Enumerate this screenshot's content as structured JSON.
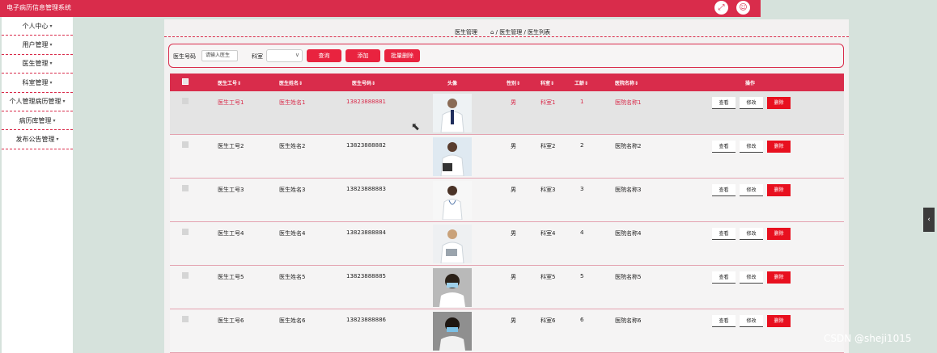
{
  "app": {
    "title": "电子病历信息管理系统"
  },
  "top_icons": [
    "fullscreen-icon",
    "user-icon"
  ],
  "sidebar": {
    "items": [
      {
        "label": "个人中心"
      },
      {
        "label": "用户管理"
      },
      {
        "label": "医生管理"
      },
      {
        "label": "科室管理"
      },
      {
        "label": "个人管理病历管理"
      },
      {
        "label": "病历库管理"
      },
      {
        "label": "发布公告管理"
      }
    ]
  },
  "breadcrumb": {
    "title": "医生管理",
    "path": "⌂ / 医生管理 / 医生列表"
  },
  "search": {
    "field_label": "医生号码",
    "placeholder": "请输入医生",
    "dept_label": "科室",
    "query_btn": "查询",
    "add_btn": "添加",
    "batch_delete_btn": "批量删除"
  },
  "table": {
    "headers": [
      "医生工号",
      "医生姓名",
      "医生号码",
      "头像",
      "性别",
      "科室",
      "工龄",
      "医院名称",
      "操作"
    ],
    "actions": {
      "view": "查看",
      "edit": "修改",
      "delete": "删除"
    },
    "rows": [
      {
        "id": "医生工号1",
        "name": "医生姓名1",
        "phone": "13823888881",
        "gender": "男",
        "dept": "科室1",
        "years": "1",
        "hospital": "医院名称1"
      },
      {
        "id": "医生工号2",
        "name": "医生姓名2",
        "phone": "13823888882",
        "gender": "男",
        "dept": "科室2",
        "years": "2",
        "hospital": "医院名称2"
      },
      {
        "id": "医生工号3",
        "name": "医生姓名3",
        "phone": "13823888883",
        "gender": "男",
        "dept": "科室3",
        "years": "3",
        "hospital": "医院名称3"
      },
      {
        "id": "医生工号4",
        "name": "医生姓名4",
        "phone": "13823888884",
        "gender": "男",
        "dept": "科室4",
        "years": "4",
        "hospital": "医院名称4"
      },
      {
        "id": "医生工号5",
        "name": "医生姓名5",
        "phone": "13823888885",
        "gender": "男",
        "dept": "科室5",
        "years": "5",
        "hospital": "医院名称5"
      },
      {
        "id": "医生工号6",
        "name": "医生姓名6",
        "phone": "13823888886",
        "gender": "男",
        "dept": "科室6",
        "years": "6",
        "hospital": "医院名称6"
      }
    ]
  },
  "watermark": "CSDN @sheji1015",
  "colors": {
    "primary": "#d92c4b",
    "delete": "#e8101f"
  }
}
